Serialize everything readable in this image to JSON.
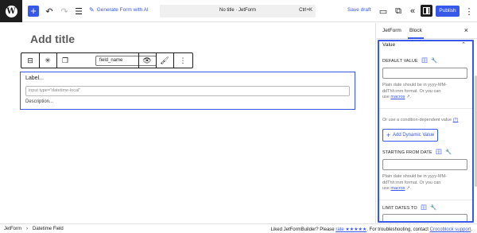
{
  "topbar": {
    "wp_logo": "W",
    "generate_ai_label": "Generate Form with AI",
    "doc_title": "No title · JetForm",
    "shortcut": "Ctrl+K",
    "save_draft": "Save draft",
    "publish": "Publish"
  },
  "editor": {
    "post_title": "Add title",
    "toolbar": {
      "field_name": "field_name"
    },
    "block": {
      "label": "Label...",
      "input_placeholder": "input type=\"datetime-local\"",
      "description": "Description..."
    }
  },
  "sidebar": {
    "tabs": [
      "JetForm",
      "Block"
    ],
    "active_tab": "Block",
    "close": "×",
    "panel": {
      "title": "Value",
      "default_value_label": "DEFAULT VALUE",
      "help_line1": "Plain date should be in yyyy-MM-",
      "help_line2": "ddThh:mm format. Or you can",
      "help_line3": "use",
      "macros": "macros",
      "condition_text": "Or use a condition-dependent value",
      "condition_q": "(?)",
      "add_dynamic": "Add Dynamic Value",
      "starting_label": "STARTING FROM DATE",
      "limit_label": "LIMIT DATES TO"
    }
  },
  "footer": {
    "breadcrumb": [
      "JetForm",
      "Datetime Field"
    ],
    "message_prefix": "Liked JetFormBuilder? Please",
    "rate": "rate ★★★★★",
    "message_suffix": ". For troubleshooting, contact",
    "support": "Crocoblock support",
    "end": "."
  },
  "colors": {
    "accent": "#3858e9",
    "dark": "#1e1e1e"
  }
}
